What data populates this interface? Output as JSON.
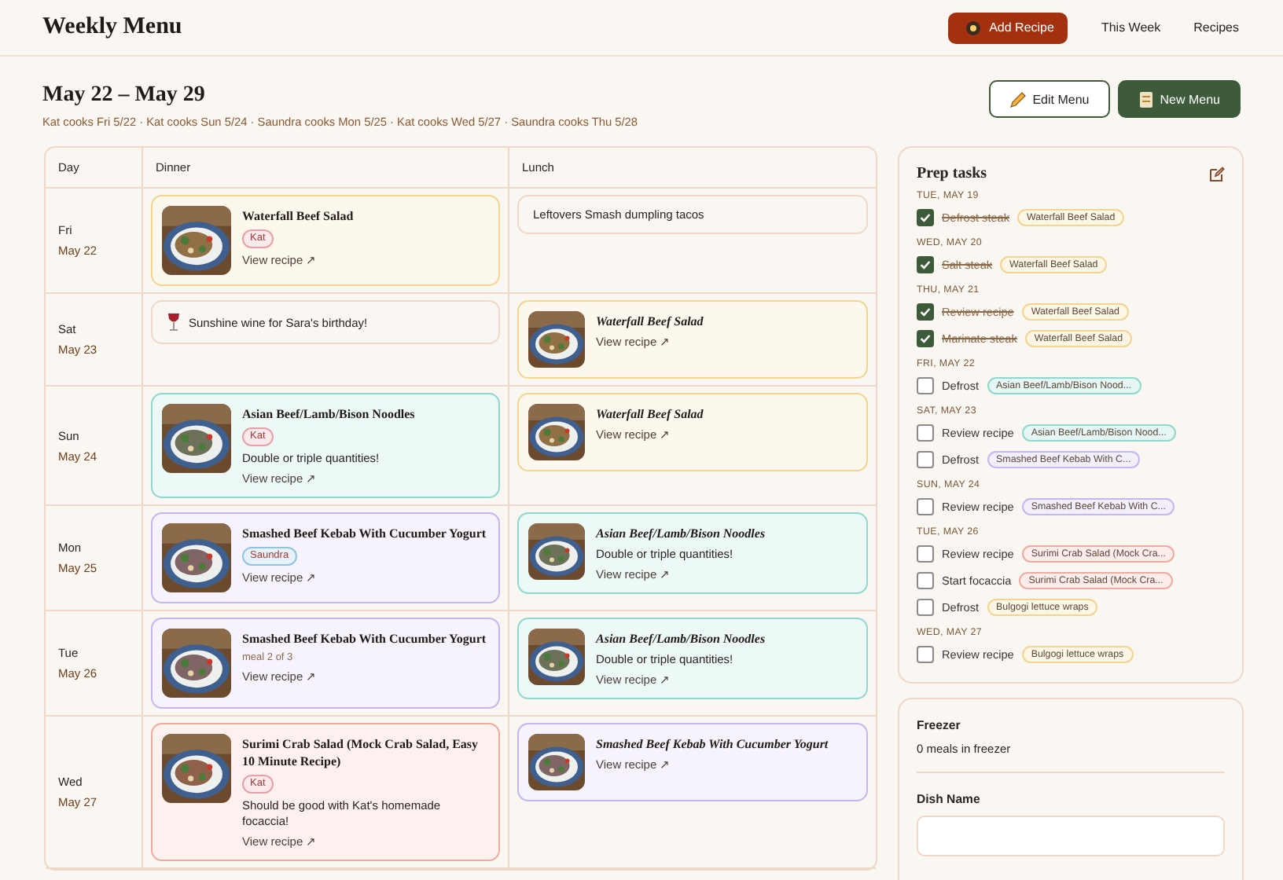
{
  "header": {
    "title": "Weekly Menu",
    "add_button": "Add Recipe",
    "nav": [
      {
        "label": "This Week",
        "selected": false
      },
      {
        "label": "Recipes",
        "selected": false
      }
    ]
  },
  "week": {
    "title": "May 22 – May 29",
    "cooks": "Kat cooks Fri 5/22 · Kat cooks Sun 5/24 · Saundra cooks Mon 5/25 · Kat cooks Wed 5/27 · Saundra cooks Thu 5/28",
    "edit_button": "Edit Menu",
    "new_button": "New Menu"
  },
  "table": {
    "columns": [
      "Day",
      "Dinner",
      "Lunch"
    ],
    "rows": [
      {
        "day": "Fri",
        "date": "May 22",
        "dinner": {
          "kind": "recipe",
          "title": "Waterfall Beef Salad",
          "color": "#f3d58f",
          "tag": {
            "label": "Kat",
            "color": "#e8a0a8"
          },
          "link": "View recipe ↗"
        },
        "lunch": {
          "kind": "note",
          "text": "Leftovers Smash dumpling tacos"
        }
      },
      {
        "day": "Sat",
        "date": "May 23",
        "dinner": {
          "kind": "celebration",
          "text": "Sunshine wine for Sara's birthday!"
        },
        "lunch": {
          "kind": "recipe",
          "title": "Waterfall Beef Salad",
          "leftover": true,
          "color": "#f3d58f",
          "link": "View recipe ↗"
        }
      },
      {
        "day": "Sun",
        "date": "May 24",
        "dinner": {
          "kind": "recipe",
          "title": "Asian Beef/Lamb/Bison Noodles",
          "color": "#8fd8cc",
          "tag": {
            "label": "Kat",
            "color": "#e8a0a8"
          },
          "note": "Double or triple quantities!",
          "link": "View recipe ↗"
        },
        "lunch": {
          "kind": "recipe",
          "title": "Waterfall Beef Salad",
          "leftover": true,
          "color": "#f3d58f",
          "link": "View recipe ↗"
        }
      },
      {
        "day": "Mon",
        "date": "May 25",
        "dinner": {
          "kind": "recipe",
          "title": "Smashed Beef Kebab With Cucumber Yogurt",
          "color": "#c6b5ee",
          "tag": {
            "label": "Saundra",
            "color": "#8fc4e0"
          },
          "link": "View recipe ↗"
        },
        "lunch": {
          "kind": "recipe",
          "title": "Asian Beef/Lamb/Bison Noodles",
          "leftover": true,
          "color": "#8fd8cc",
          "note": "Double or triple quantities!",
          "link": "View recipe ↗"
        }
      },
      {
        "day": "Tue",
        "date": "May 26",
        "dinner": {
          "kind": "recipe",
          "title": "Smashed Beef Kebab With Cucumber Yogurt",
          "color": "#c6b5ee",
          "meal_info": "meal 2 of 3",
          "link": "View recipe ↗"
        },
        "lunch": {
          "kind": "recipe",
          "title": "Asian Beef/Lamb/Bison Noodles",
          "leftover": true,
          "color": "#8fd8cc",
          "note": "Double or triple quantities!",
          "link": "View recipe ↗"
        }
      },
      {
        "day": "Wed",
        "date": "May 27",
        "dinner": {
          "kind": "recipe",
          "title": "Surimi Crab Salad (Mock Crab Salad, Easy 10 Minute Recipe)",
          "color": "#f0aaa0",
          "tag": {
            "label": "Kat",
            "color": "#e8a0a8"
          },
          "note": "Should be good with Kat's homemade focaccia!",
          "link": "View recipe ↗"
        },
        "lunch": {
          "kind": "recipe",
          "title": "Smashed Beef Kebab With Cucumber Yogurt",
          "leftover": true,
          "color": "#c6b5ee",
          "link": "View recipe ↗"
        }
      }
    ]
  },
  "prep": {
    "title": "Prep tasks",
    "groups": [
      {
        "date": "TUE, MAY 19",
        "tasks": [
          {
            "label": "Defrost steak",
            "checked": true,
            "recipe": "Waterfall Beef Salad",
            "color": "#f3d58f"
          }
        ]
      },
      {
        "date": "WED, MAY 20",
        "tasks": [
          {
            "label": "Salt steak",
            "checked": true,
            "recipe": "Waterfall Beef Salad",
            "color": "#f3d58f"
          }
        ]
      },
      {
        "date": "THU, MAY 21",
        "tasks": [
          {
            "label": "Review recipe",
            "checked": true,
            "recipe": "Waterfall Beef Salad",
            "color": "#f3d58f"
          },
          {
            "label": "Marinate steak",
            "checked": true,
            "recipe": "Waterfall Beef Salad",
            "color": "#f3d58f"
          }
        ]
      },
      {
        "date": "FRI, MAY 22",
        "tasks": [
          {
            "label": "Defrost",
            "checked": false,
            "recipe": "Asian Beef/Lamb/Bison Nood...",
            "color": "#8fd8cc"
          }
        ]
      },
      {
        "date": "SAT, MAY 23",
        "tasks": [
          {
            "label": "Review recipe",
            "checked": false,
            "recipe": "Asian Beef/Lamb/Bison Nood...",
            "color": "#8fd8cc"
          },
          {
            "label": "Defrost",
            "checked": false,
            "recipe": "Smashed Beef Kebab With C...",
            "color": "#c6b5ee"
          }
        ]
      },
      {
        "date": "SUN, MAY 24",
        "tasks": [
          {
            "label": "Review recipe",
            "checked": false,
            "recipe": "Smashed Beef Kebab With C...",
            "color": "#c6b5ee"
          }
        ]
      },
      {
        "date": "TUE, MAY 26",
        "tasks": [
          {
            "label": "Review recipe",
            "checked": false,
            "recipe": "Surimi Crab Salad (Mock Cra...",
            "color": "#f0aaa0"
          },
          {
            "label": "Start focaccia",
            "checked": false,
            "recipe": "Surimi Crab Salad (Mock Cra...",
            "color": "#f0aaa0"
          },
          {
            "label": "Defrost",
            "checked": false,
            "recipe": "Bulgogi lettuce wraps",
            "color": "#f3d58f"
          }
        ]
      },
      {
        "date": "WED, MAY 27",
        "tasks": [
          {
            "label": "Review recipe",
            "checked": false,
            "recipe": "Bulgogi lettuce wraps",
            "color": "#f3d58f"
          }
        ]
      }
    ]
  },
  "freezer": {
    "title": "Freezer",
    "count": "0 meals in freezer",
    "field_label": "Dish Name"
  }
}
